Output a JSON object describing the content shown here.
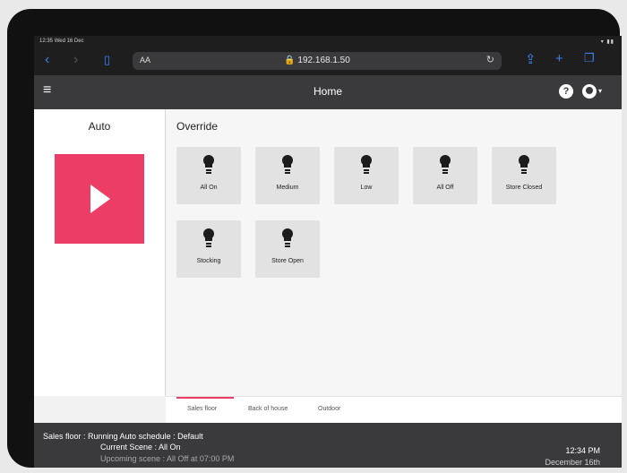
{
  "status": {
    "time": "12:35",
    "date": "Wed 16 Dec"
  },
  "safari": {
    "aa_label": "AA",
    "url": "🔒 192.168.1.50"
  },
  "app": {
    "title": "Home",
    "help_label": "?"
  },
  "auto": {
    "title": "Auto"
  },
  "override": {
    "title": "Override",
    "buttons": [
      {
        "label": "All On"
      },
      {
        "label": "Medium"
      },
      {
        "label": "Low"
      },
      {
        "label": "All Off"
      },
      {
        "label": "Store Closed"
      },
      {
        "label": "Stocking"
      },
      {
        "label": "Store Open"
      }
    ]
  },
  "tabs": [
    {
      "label": "Sales floor",
      "active": true
    },
    {
      "label": "Back of house",
      "active": false
    },
    {
      "label": "Outdoor",
      "active": false
    }
  ],
  "footer": {
    "line1": "Sales floor : Running Auto schedule : Default",
    "line2": "Current Scene : All On",
    "line3": "Upcoming scene : All Off at 07:00 PM",
    "time": "12:34 PM",
    "date": "December 16th"
  },
  "colors": {
    "accent": "#ec3d67",
    "header": "#3a3a3d",
    "ios_blue": "#3b83f6"
  }
}
